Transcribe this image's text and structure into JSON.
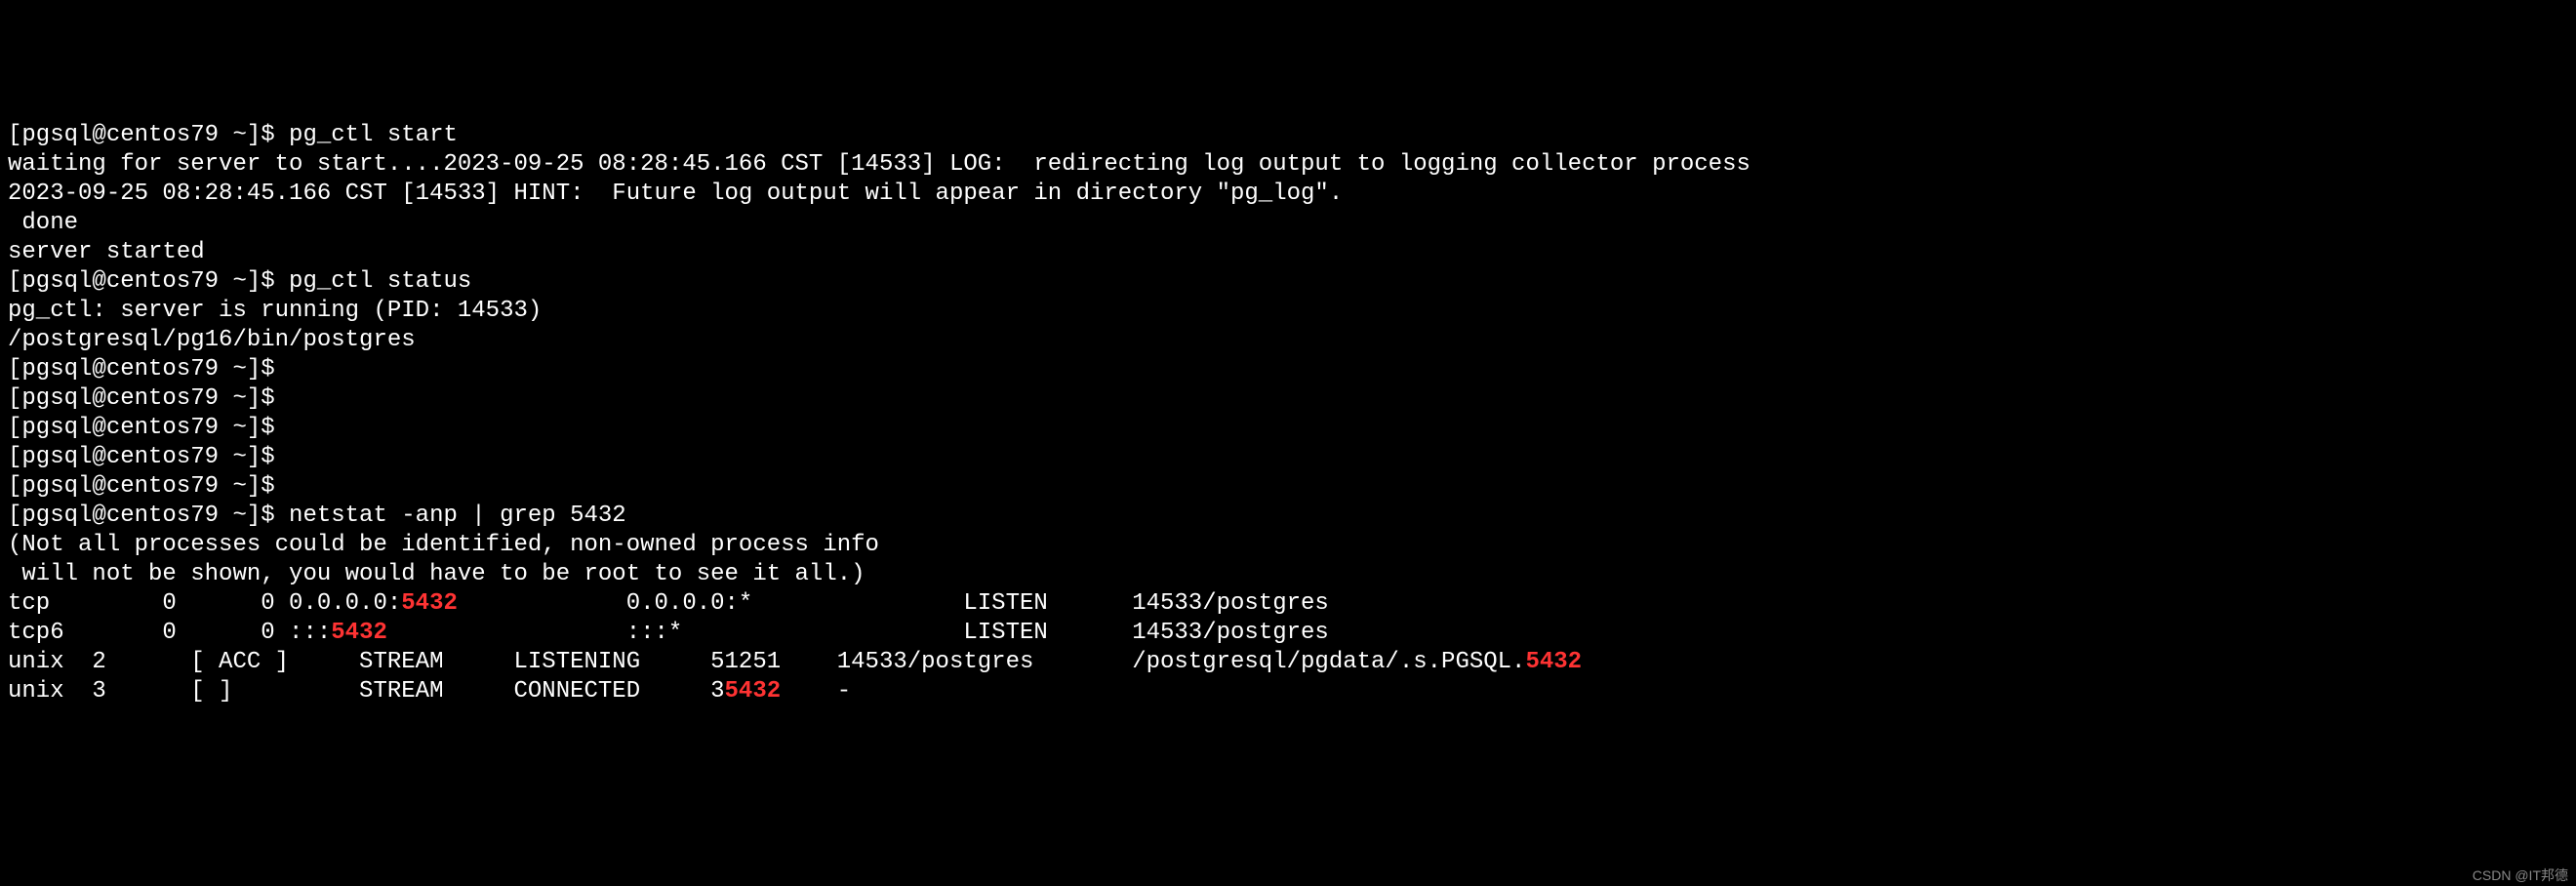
{
  "lines": [
    {
      "segments": [
        {
          "t": "[pgsql@centos79 ~]$ pg_ctl start",
          "hl": false
        }
      ]
    },
    {
      "segments": [
        {
          "t": "waiting for server to start....2023-09-25 08:28:45.166 CST [14533] LOG:  redirecting log output to logging collector process",
          "hl": false
        }
      ]
    },
    {
      "segments": [
        {
          "t": "2023-09-25 08:28:45.166 CST [14533] HINT:  Future log output will appear in directory \"pg_log\".",
          "hl": false
        }
      ]
    },
    {
      "segments": [
        {
          "t": " done",
          "hl": false
        }
      ]
    },
    {
      "segments": [
        {
          "t": "server started",
          "hl": false
        }
      ]
    },
    {
      "segments": [
        {
          "t": "[pgsql@centos79 ~]$ pg_ctl status",
          "hl": false
        }
      ]
    },
    {
      "segments": [
        {
          "t": "pg_ctl: server is running (PID: 14533)",
          "hl": false
        }
      ]
    },
    {
      "segments": [
        {
          "t": "/postgresql/pg16/bin/postgres",
          "hl": false
        }
      ]
    },
    {
      "segments": [
        {
          "t": "[pgsql@centos79 ~]$ ",
          "hl": false
        }
      ]
    },
    {
      "segments": [
        {
          "t": "[pgsql@centos79 ~]$ ",
          "hl": false
        }
      ]
    },
    {
      "segments": [
        {
          "t": "[pgsql@centos79 ~]$ ",
          "hl": false
        }
      ]
    },
    {
      "segments": [
        {
          "t": "[pgsql@centos79 ~]$ ",
          "hl": false
        }
      ]
    },
    {
      "segments": [
        {
          "t": "[pgsql@centos79 ~]$ ",
          "hl": false
        }
      ]
    },
    {
      "segments": [
        {
          "t": "[pgsql@centos79 ~]$ netstat -anp | grep 5432",
          "hl": false
        }
      ]
    },
    {
      "segments": [
        {
          "t": "(Not all processes could be identified, non-owned process info",
          "hl": false
        }
      ]
    },
    {
      "segments": [
        {
          "t": " will not be shown, you would have to be root to see it all.)",
          "hl": false
        }
      ]
    },
    {
      "segments": [
        {
          "t": "tcp        0      0 0.0.0.0:",
          "hl": false
        },
        {
          "t": "5432",
          "hl": true
        },
        {
          "t": "            0.0.0.0:*               LISTEN      14533/postgres",
          "hl": false
        }
      ]
    },
    {
      "segments": [
        {
          "t": "tcp6       0      0 :::",
          "hl": false
        },
        {
          "t": "5432",
          "hl": true
        },
        {
          "t": "                 :::*                    LISTEN      14533/postgres",
          "hl": false
        }
      ]
    },
    {
      "segments": [
        {
          "t": "unix  2      [ ACC ]     STREAM     LISTENING     51251    14533/postgres       /postgresql/pgdata/.s.PGSQL.",
          "hl": false
        },
        {
          "t": "5432",
          "hl": true
        }
      ]
    },
    {
      "segments": [
        {
          "t": "unix  3      [ ]         STREAM     CONNECTED     3",
          "hl": false
        },
        {
          "t": "5432",
          "hl": true
        },
        {
          "t": "    -",
          "hl": false
        }
      ]
    }
  ],
  "watermark": "CSDN @IT邦德"
}
